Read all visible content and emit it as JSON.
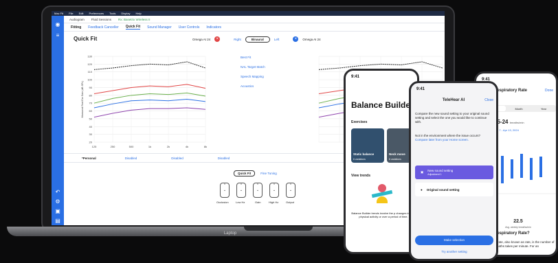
{
  "laptop": {
    "label": "Laptop",
    "menu": [
      "Mac Fit",
      "File",
      "Edit",
      "Preferences",
      "Tools",
      "Display",
      "Help"
    ],
    "toolbar1": {
      "audiogram": "Audiogram",
      "fluid_sessions": "Fluid Sessions",
      "device_status": "Rx: Basetrix Wireless II"
    },
    "nav": {
      "first": "Fitting",
      "items": [
        "Feedback Canceller",
        "Quick Fit",
        "Sound Manager",
        "User Controls",
        "Indicators"
      ],
      "active_index": 1
    },
    "quickfit": {
      "title": "Quick Fit",
      "left_device": "Omega AI 24",
      "ears": [
        "Right",
        "Binaural",
        "Left"
      ],
      "right_device": "Omega AI 24",
      "links": [
        "Best Fit",
        "NAL Target Match",
        "Speech Mapping",
        "Acoustics"
      ]
    },
    "chart_data": {
      "type": "line",
      "ylabel": "Measured Real Ear Gain (dB SPL)",
      "x": [
        "125",
        "250",
        "500",
        "1k",
        "2k",
        "4k",
        "8k"
      ],
      "yticks": [
        20,
        30,
        40,
        50,
        60,
        70,
        80,
        90,
        100,
        110,
        120,
        130
      ],
      "ylim": [
        20,
        130
      ],
      "series": [
        {
          "color": "#222222",
          "values": [
            113,
            115,
            118,
            120,
            119,
            123,
            115
          ]
        },
        {
          "color": "#e14545",
          "values": [
            82,
            86,
            90,
            92,
            91,
            94,
            89
          ]
        },
        {
          "color": "#6ab04c",
          "values": [
            70,
            76,
            80,
            82,
            81,
            83,
            79
          ]
        },
        {
          "color": "#2a6fe4",
          "values": [
            64,
            69,
            73,
            74,
            73,
            75,
            72
          ]
        },
        {
          "color": "#8e44ad",
          "values": [
            52,
            57,
            61,
            63,
            63,
            64,
            62
          ]
        }
      ]
    },
    "bottom_tabs": [
      "*Personal",
      "Disabled",
      "Disabled",
      "Disabled"
    ],
    "fit_tabs": [
      "Quick Fit",
      "Fine Tuning"
    ],
    "knobs": [
      "Occlusion",
      "Low Hz",
      "Gain",
      "High Hz",
      "Output"
    ]
  },
  "phone1": {
    "time": "9:41",
    "title": "Balance Builder",
    "exercises_label": "Exercises",
    "cards": [
      {
        "title": "Static balance",
        "sub": "6 variations"
      },
      {
        "title": "Neck move",
        "sub": "6 variations"
      }
    ],
    "trends_label": "View trends",
    "trends_text": "Balance Builder trends involve the p changes in your physical activity or over a period of time."
  },
  "phone2": {
    "time": "9:41",
    "title": "TeleHear AI",
    "close": "Close",
    "p1": "Compare the new sound setting to your original sound setting and select the one you would like to continue with.",
    "p2": "Not in the environment where the issue occurs?",
    "p2_link": "Compare later from your Home screen.",
    "option1": {
      "title": "New sound setting",
      "sub": "Adjustment 1"
    },
    "option2": {
      "title": "Original sound setting"
    },
    "primary": "Make selection",
    "secondary": "Try another setting"
  },
  "phone3": {
    "time": "9:41",
    "title": "Respiratory Rate",
    "done": "Done",
    "segments": [
      "Week",
      "Month",
      "Year"
    ],
    "big": "15-24",
    "big_unit": "breaths/min",
    "date": "Apr 7 - Apr 13, 2024",
    "avg": "22.5",
    "avg_label": "Avg. weekly breaths/min",
    "q": "Respiratory Rate?",
    "body": "ry rate, also known as rate, is the number of breaths takes per minute. For an"
  }
}
